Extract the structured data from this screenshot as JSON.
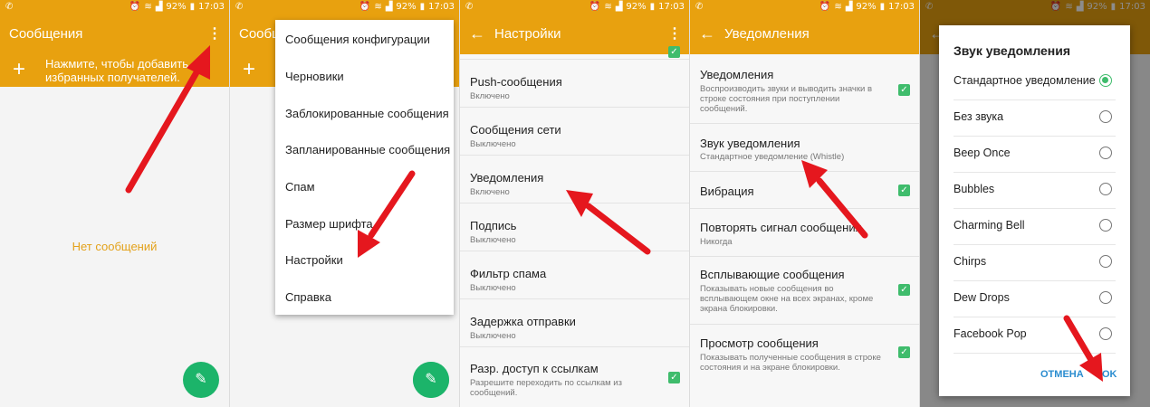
{
  "status": {
    "time": "17:03",
    "battery": "92%"
  },
  "panel1": {
    "title": "Сообщения",
    "add_hint": "Нажмите, чтобы добавить избранных получателей.",
    "empty": "Нет сообщений"
  },
  "panel2": {
    "title": "Сообщ",
    "menu": [
      "Сообщения конфигурации",
      "Черновики",
      "Заблокированные сообщения",
      "Запланированные сообщения",
      "Спам",
      "Размер шрифта",
      "Настройки",
      "Справка"
    ]
  },
  "panel3": {
    "title": "Настройки",
    "rows": [
      {
        "title": "Push-сообщения",
        "sub": "Включено"
      },
      {
        "title": "Сообщения сети",
        "sub": "Выключено"
      },
      {
        "title": "Уведомления",
        "sub": "Включено"
      },
      {
        "title": "Подпись",
        "sub": "Выключено"
      },
      {
        "title": "Фильтр спама",
        "sub": "Выключено"
      },
      {
        "title": "Задержка отправки",
        "sub": "Выключено"
      },
      {
        "title": "Разр. доступ к ссылкам",
        "sub": "Разрешите переходить по ссылкам из сообщений."
      }
    ]
  },
  "panel4": {
    "title": "Уведомления",
    "rows": [
      {
        "title": "Уведомления",
        "sub": "Воспроизводить звуки и выводить значки в строке состояния при поступлении сообщений."
      },
      {
        "title": "Звук уведомления",
        "sub": "Стандартное уведомление (Whistle)"
      },
      {
        "title": "Вибрация",
        "sub": ""
      },
      {
        "title": "Повторять сигнал сообщения",
        "sub": "Никогда"
      },
      {
        "title": "Всплывающие сообщения",
        "sub": "Показывать новые сообщения во всплывающем окне на всех экранах, кроме экрана блокировки."
      },
      {
        "title": "Просмотр сообщения",
        "sub": "Показывать полученные сообщения в строке состояния и на экране блокировки."
      }
    ]
  },
  "panel5": {
    "dialog_title": "Звук уведомления",
    "options": [
      "Стандартное уведомление",
      "Без звука",
      "Beep Once",
      "Bubbles",
      "Charming Bell",
      "Chirps",
      "Dew Drops",
      "Facebook Pop"
    ],
    "selected": "Стандартное уведомление",
    "cancel": "ОТМЕНА",
    "ok": "OK"
  },
  "colors": {
    "accent": "#e8a10f",
    "fab": "#1cb46a",
    "check": "#3fbc6c",
    "arrow": "#e5171e"
  }
}
